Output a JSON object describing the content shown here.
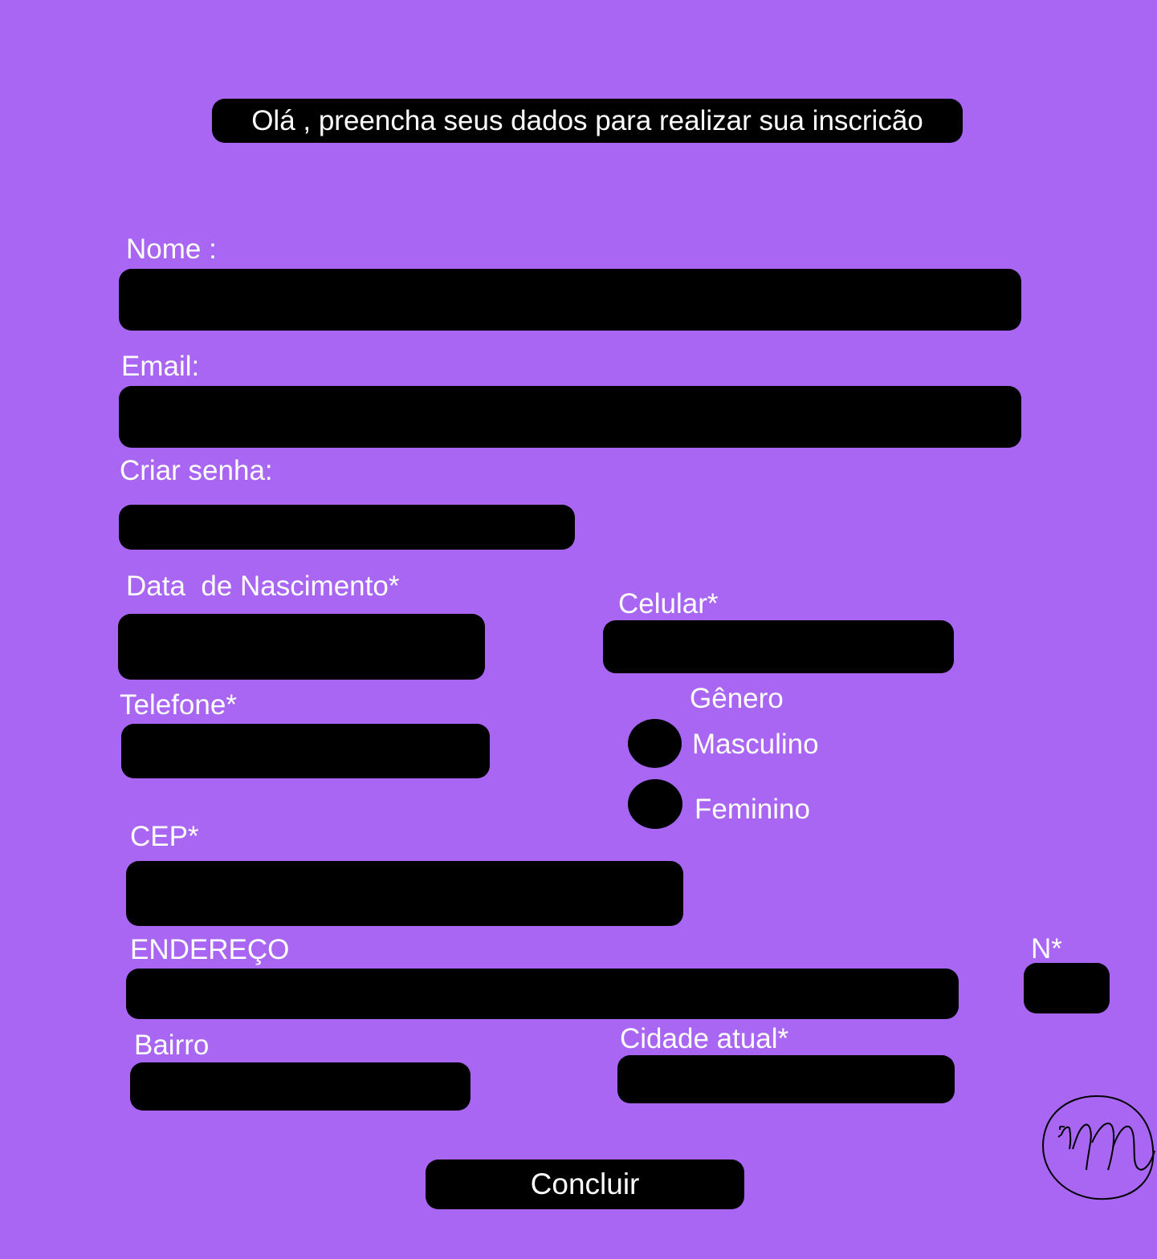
{
  "header": {
    "title": "Olá , preencha seus dados para realizar  sua inscricão"
  },
  "form": {
    "nome_label": "Nome :",
    "email_label": "Email:",
    "senha_label": "Criar senha:",
    "nascimento_label": "Data  de Nascimento*",
    "celular_label": "Celular*",
    "telefone_label": "Telefone*",
    "genero_label": "Gênero",
    "genero_options": [
      "Masculino",
      "Feminino"
    ],
    "cep_label": "CEP*",
    "endereco_label": "ENDEREÇO",
    "numero_label": "N*",
    "bairro_label": "Bairro",
    "cidade_label": "Cidade atual*",
    "submit_label": "Concluir"
  },
  "colors": {
    "background": "#a866f2",
    "field": "#000000",
    "text": "#ffffff"
  },
  "icons": {
    "logo": "m-monogram-logo"
  }
}
